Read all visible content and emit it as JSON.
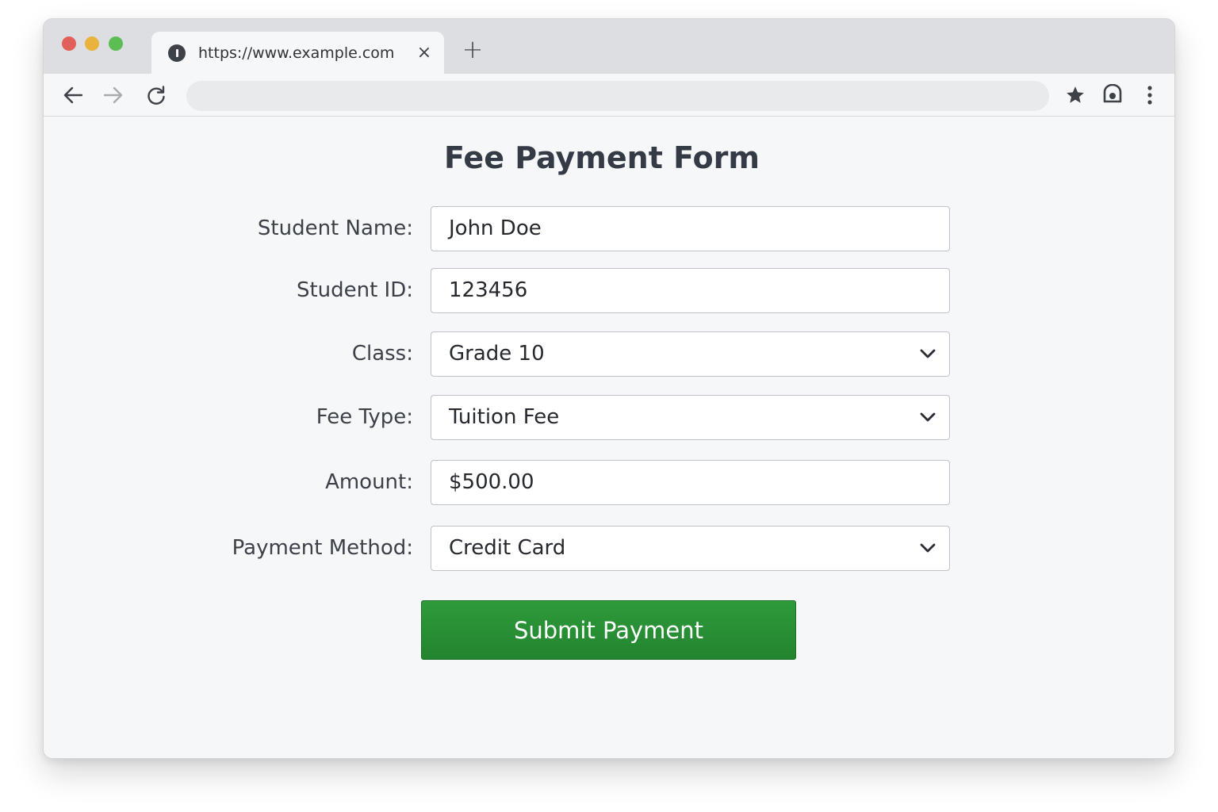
{
  "browser": {
    "tab": {
      "title": "https://www.example.com",
      "close_label": "×",
      "favicon": "info-icon"
    },
    "new_tab_label": "+",
    "address_bar": {
      "value": ""
    },
    "icons": [
      "back-arrow-icon",
      "forward-arrow-icon",
      "reload-icon",
      "star-icon",
      "extension-icon",
      "kebab-menu-icon"
    ]
  },
  "form": {
    "title": "Fee Payment Form",
    "fields": [
      {
        "label": "Student Name:",
        "value": "John Doe",
        "type": "text"
      },
      {
        "label": "Student ID:",
        "value": "123456",
        "type": "text"
      },
      {
        "label": "Class:",
        "value": "Grade 10",
        "type": "select"
      },
      {
        "label": "Fee Type:",
        "value": "Tuition Fee",
        "type": "select"
      },
      {
        "label": "Amount:",
        "value": "$500.00",
        "type": "text"
      },
      {
        "label": "Payment Method:",
        "value": "Credit Card",
        "type": "select"
      }
    ],
    "submit_label": "Submit Payment"
  },
  "colors": {
    "submit_button": "#2a9236",
    "traffic_red": "#e2605a",
    "traffic_yellow": "#e9b33d",
    "traffic_green": "#5dbd55"
  }
}
